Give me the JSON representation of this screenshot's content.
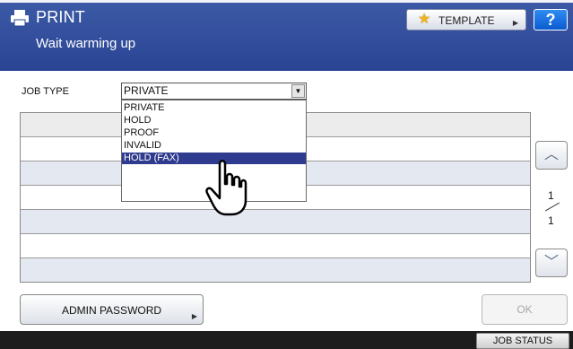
{
  "header": {
    "title": "PRINT",
    "status_message": "Wait warming up",
    "template_button": "TEMPLATE",
    "help_button": "?",
    "icons": {
      "printer": "printer-icon",
      "template": "star-icon"
    }
  },
  "job_type": {
    "label": "JOB TYPE",
    "selected": "PRIVATE",
    "options": [
      "PRIVATE",
      "HOLD",
      "PROOF",
      "INVALID",
      "HOLD (FAX)"
    ],
    "highlighted_option": "HOLD (FAX)"
  },
  "pager": {
    "current": "1",
    "total": "1"
  },
  "buttons": {
    "admin_password": "ADMIN PASSWORD",
    "ok": "OK",
    "job_status": "JOB STATUS"
  },
  "colors": {
    "title_bar": "#2f4c9e",
    "selection": "#2f3b8e",
    "help_button": "#1a6fe0",
    "footer": "#1d1d1d"
  }
}
